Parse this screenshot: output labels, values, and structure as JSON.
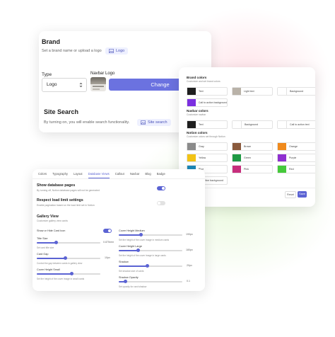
{
  "brand": {
    "title": "Brand",
    "subtitle": "Set a brand name or upload a logo",
    "logo_chip": "Logo",
    "type_label": "Type",
    "type_value": "Logo",
    "navbar_logo_label": "Navbar Logo",
    "change_button": "Change",
    "site_search_title": "Site Search",
    "site_search_subtitle": "By turning on, you will enable search functionality.",
    "site_search_chip": "Site search"
  },
  "colors": {
    "brand_title": "Brand colors",
    "brand_sub": "Customize and set brand colors",
    "brand_items": [
      {
        "label": "Text",
        "color": "#1e1e1e"
      },
      {
        "label": "Light text",
        "color": "#b9b2a8"
      },
      {
        "label": "Background",
        "color": "#ffffff"
      },
      {
        "label": "Call to action background",
        "color": "#7b2fe0"
      }
    ],
    "navbar_title": "Navbar colors",
    "navbar_sub": "Customize navbar",
    "navbar_items": [
      {
        "label": "Text",
        "color": "#1e1e1e"
      },
      {
        "label": "Background",
        "color": "#ffffff"
      },
      {
        "label": "Call to action text",
        "color": "#ffffff"
      }
    ],
    "notion_title": "Notion colors",
    "notion_sub": "Customize colors set through Notion",
    "notion_items": [
      {
        "label": "Gray",
        "color": "#8b8b8b"
      },
      {
        "label": "Brown",
        "color": "#8a5a3c"
      },
      {
        "label": "Orange",
        "color": "#f08a1c"
      },
      {
        "label": "Yellow",
        "color": "#f2c315"
      },
      {
        "label": "Green",
        "color": "#1f9a45"
      },
      {
        "label": "Purple",
        "color": "#8f2fd0"
      },
      {
        "label": "Blue",
        "color": "#1b88b8"
      },
      {
        "label": "Pink",
        "color": "#c72e7c"
      },
      {
        "label": "Red",
        "color": "#45c93a"
      },
      {
        "label": "Hoverline background",
        "color": "#3f45c6"
      }
    ],
    "reset_button": "Reset",
    "save_button": "Save"
  },
  "settings": {
    "tabs": [
      "Colors",
      "Typography",
      "Layout",
      "Database Views",
      "Callout",
      "Navbar",
      "Blog",
      "Badge"
    ],
    "active_tab": 3,
    "show_db_title": "Show database pages",
    "show_db_sub": "By turning off, Notion database pages will not be generated",
    "respect_title": "Respect load limit settings",
    "respect_sub": "Enable pagination based on the load limit set in Notion",
    "gallery_title": "Gallery View",
    "gallery_sub": "Customize gallery view cards",
    "show_hide_label": "Show or Hide Card Icon",
    "title_size_label": "Title Size",
    "title_size_value": "0.875rem",
    "title_size_hint": "Set card title size",
    "title_size_fraction": 0.3,
    "card_gap_label": "Card Gap",
    "card_gap_value": "10px",
    "card_gap_hint": "Control the gap between cards in gallery view",
    "card_gap_fraction": 0.45,
    "cover_small_label": "Cover Height Small",
    "cover_small_value": "",
    "cover_small_hint": "Set the height of the cover image in small cards",
    "cover_small_fraction": 0.55,
    "cover_medium_label": "Cover Height Medium",
    "cover_medium_value": "190px",
    "cover_medium_hint": "Set the height of the cover image in medium cards",
    "cover_medium_fraction": 0.35,
    "cover_large_label": "Cover Height Large",
    "cover_large_value": "180px",
    "cover_large_hint": "Set the height of the cover image in large cards",
    "cover_large_fraction": 0.3,
    "shadow_label": "Shadow",
    "shadow_value": "20px",
    "shadow_hint": "Set shadow size of cards",
    "shadow_fraction": 0.45,
    "shadow_opacity_label": "Shadow Opacity",
    "shadow_opacity_value": "0.1",
    "shadow_opacity_hint": "Set opacity for card shadow",
    "shadow_opacity_fraction": 0.1
  },
  "accent_color": "#5b63d3"
}
